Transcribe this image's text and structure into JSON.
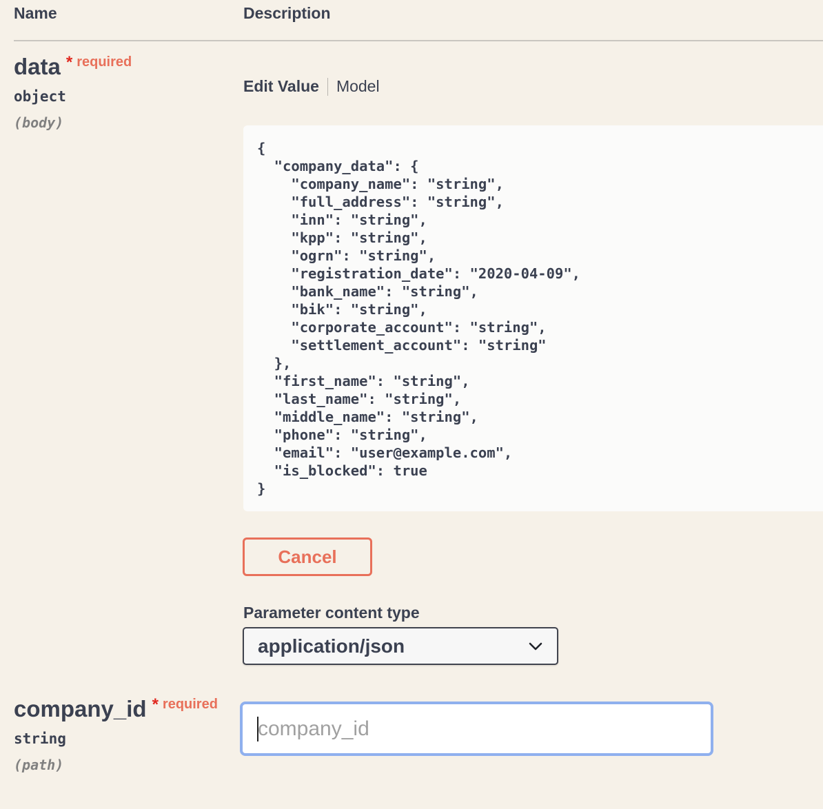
{
  "header": {
    "name_col": "Name",
    "description_col": "Description"
  },
  "params": [
    {
      "name": "data",
      "required_star": "*",
      "required_label": "required",
      "type": "object",
      "in": "(body)"
    },
    {
      "name": "company_id",
      "required_star": "*",
      "required_label": "required",
      "type": "string",
      "in": "(path)"
    }
  ],
  "tabs": {
    "edit_value": "Edit Value",
    "model": "Model"
  },
  "body_value": "{\n  \"company_data\": {\n    \"company_name\": \"string\",\n    \"full_address\": \"string\",\n    \"inn\": \"string\",\n    \"kpp\": \"string\",\n    \"ogrn\": \"string\",\n    \"registration_date\": \"2020-04-09\",\n    \"bank_name\": \"string\",\n    \"bik\": \"string\",\n    \"corporate_account\": \"string\",\n    \"settlement_account\": \"string\"\n  },\n  \"first_name\": \"string\",\n  \"last_name\": \"string\",\n  \"middle_name\": \"string\",\n  \"phone\": \"string\",\n  \"email\": \"user@example.com\",\n  \"is_blocked\": true\n}",
  "cancel_label": "Cancel",
  "content_type": {
    "label": "Parameter content type",
    "selected": "application/json",
    "icon": "chevron-down-icon"
  },
  "company_id_input": {
    "placeholder": "company_id",
    "value": ""
  },
  "colors": {
    "background": "#f6f1e8",
    "required": "#e0281f",
    "cancel": "#e8705a",
    "focus_border": "#8fb0ee"
  }
}
